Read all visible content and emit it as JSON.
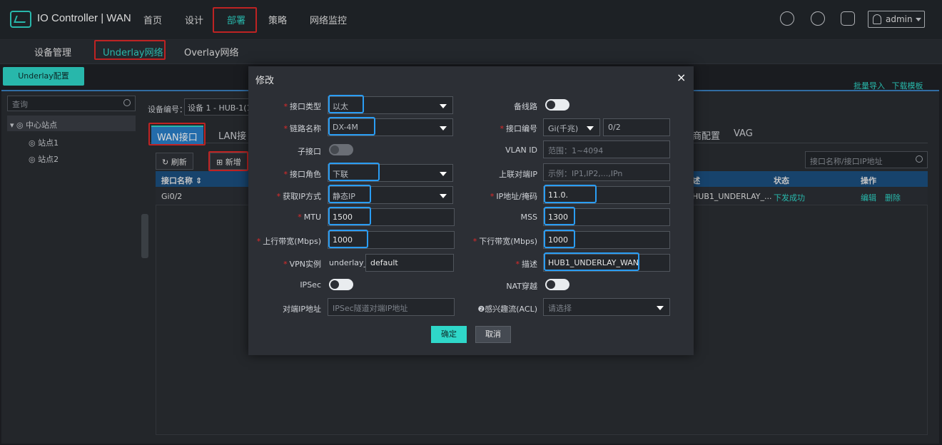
{
  "app": {
    "title": "IO Controller | WAN",
    "user": "admin"
  },
  "nav": [
    {
      "label": "首页"
    },
    {
      "label": "设计"
    },
    {
      "label": "部署"
    },
    {
      "label": "策略"
    },
    {
      "label": "网络监控"
    }
  ],
  "subnav": [
    {
      "label": "设备管理"
    },
    {
      "label": "Underlay网络"
    },
    {
      "label": "Overlay网络"
    }
  ],
  "toolbar": {
    "config_button": "Underlay配置",
    "bulk_import": "批量导入",
    "download_template": "下载模板"
  },
  "sidebar": {
    "search_placeholder": "查询",
    "tree": [
      {
        "label": "中心站点"
      },
      {
        "label": "站点1"
      },
      {
        "label": "站点2"
      }
    ]
  },
  "device": {
    "label": "设备编号：",
    "value": "设备 1 - HUB-1(11"
  },
  "tabs": [
    {
      "label": "WAN接口"
    },
    {
      "label": "LAN接"
    },
    {
      "label": "商配置"
    },
    {
      "label": "VAG"
    }
  ],
  "actions": {
    "refresh": "刷新",
    "add": "新增",
    "search_placeholder": "接口名称/接口IP地址"
  },
  "table": {
    "headers": {
      "name": "接口名称",
      "desc": "述",
      "status": "状态",
      "ops": "操作"
    },
    "rows": [
      {
        "name": "Gi0/2",
        "desc": "HUB1_UNDERLAY_...",
        "status": "下发成功",
        "edit": "编辑",
        "delete": "删除"
      }
    ],
    "status_color": "#2fd7c9"
  },
  "modal": {
    "title": "修改",
    "close": "×",
    "fields": {
      "iface_type": {
        "label": "接口类型",
        "value": "以太"
      },
      "backup_line": {
        "label": "备线路",
        "on": true
      },
      "link_name": {
        "label": "链路名称",
        "value": "DX-4M"
      },
      "iface_no": {
        "label": "接口编号",
        "type_value": "Gi(千兆)",
        "num_value": "0/2"
      },
      "sub_iface": {
        "label": "子接口",
        "on": false
      },
      "vlan": {
        "label": "VLAN ID",
        "placeholder": "范围：1~4094"
      },
      "role": {
        "label": "接口角色",
        "value": "下联"
      },
      "peer_ip": {
        "label": "上联对端IP",
        "placeholder": "示例：IP1,IP2,...,IPn"
      },
      "ip_method": {
        "label": "获取IP方式",
        "value": "静态IP"
      },
      "ip_mask": {
        "label": "IP地址/掩码",
        "value": "11.0."
      },
      "mtu": {
        "label": "MTU",
        "value": "1500"
      },
      "mss": {
        "label": "MSS",
        "value": "1300"
      },
      "up_bw": {
        "label": "上行带宽(Mbps)",
        "value": "1000"
      },
      "down_bw": {
        "label": "下行带宽(Mbps)",
        "value": "1000"
      },
      "vpn": {
        "label": "VPN实例",
        "prefix": "underlay_",
        "value": "default"
      },
      "desc": {
        "label": "描述",
        "value": "HUB1_UNDERLAY_WAN"
      },
      "ipsec": {
        "label": "IPSec",
        "on": true
      },
      "nat": {
        "label": "NAT穿越",
        "on": true
      },
      "peer_addr": {
        "label": "对端IP地址",
        "placeholder": "IPSec隧道对端IP地址"
      },
      "acl": {
        "label": "感兴趣流(ACL)",
        "placeholder": "请选择"
      }
    },
    "ok": "确定",
    "cancel": "取消"
  }
}
